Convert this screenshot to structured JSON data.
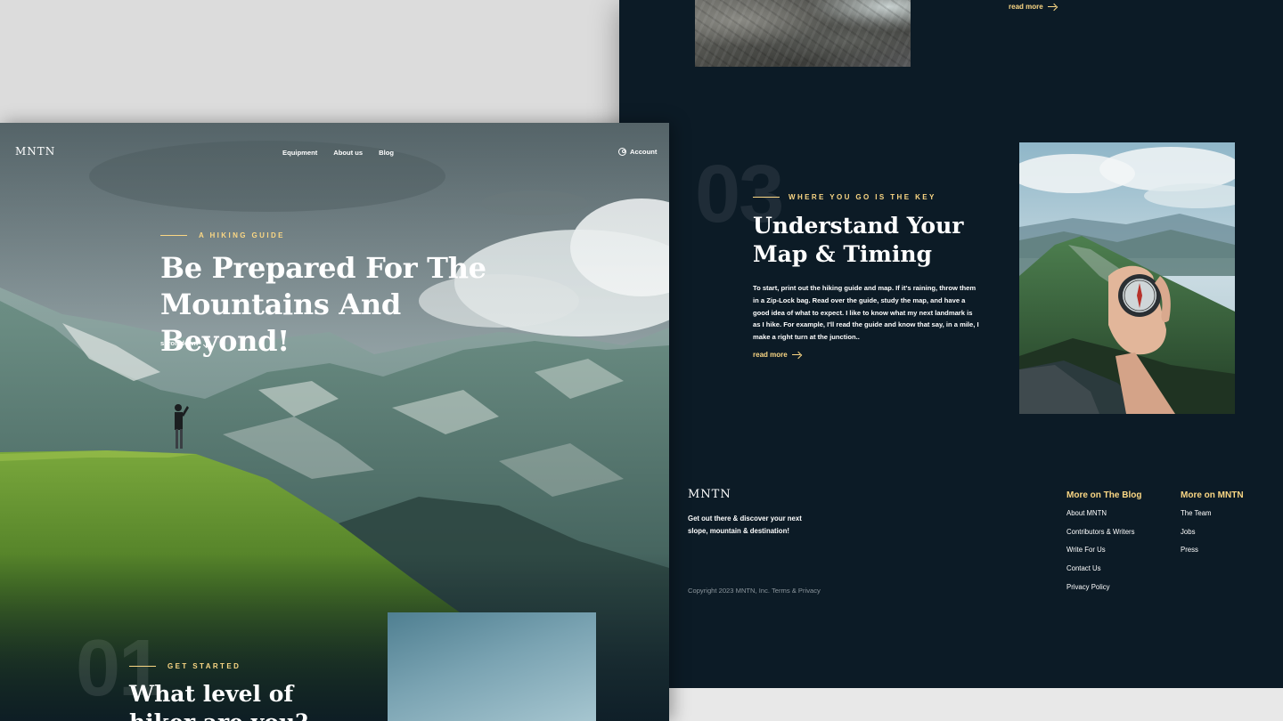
{
  "back_panel": {
    "top_read_more": "read more",
    "section_number": "03",
    "eyebrow": "WHERE YOU GO IS THE KEY",
    "title": "Understand Your Map & Timing",
    "body": "To start, print out the hiking guide and map. If it's raining, throw them in a Zip-Lock bag. Read over the guide, study the map, and have a good idea of what to expect. I like to know what my next landmark is as I hike. For example, I'll read the guide and know that say, in a mile, I make a right turn at the junction..",
    "read_more": "read more"
  },
  "footer": {
    "logo": "MNTN",
    "tagline": "Get out there & discover your next slope, mountain & destination!",
    "copyright": "Copyright 2023 MNTN, Inc. Terms & Privacy",
    "columns": [
      {
        "title": "More on The Blog",
        "links": [
          "About MNTN",
          "Contributors & Writers",
          "Write For Us",
          "Contact Us",
          "Privacy Policy"
        ]
      },
      {
        "title": "More on MNTN",
        "links": [
          "The Team",
          "Jobs",
          "Press"
        ]
      }
    ]
  },
  "hero": {
    "logo": "MNTN",
    "nav": [
      "Equipment",
      "About us",
      "Blog"
    ],
    "account": "Account",
    "eyebrow": "A HIKING GUIDE",
    "title": "Be Prepared For The Mountains And Beyond!",
    "scroll": "scroll down"
  },
  "section1": {
    "number": "01",
    "eyebrow": "GET STARTED",
    "title": "What level of hiker are you?"
  },
  "colors": {
    "accent": "#fbd784",
    "dark_bg": "#0c1b26",
    "text": "#ffffff"
  },
  "icons": [
    "user-icon",
    "arrow-right-icon",
    "arrow-down-icon"
  ]
}
